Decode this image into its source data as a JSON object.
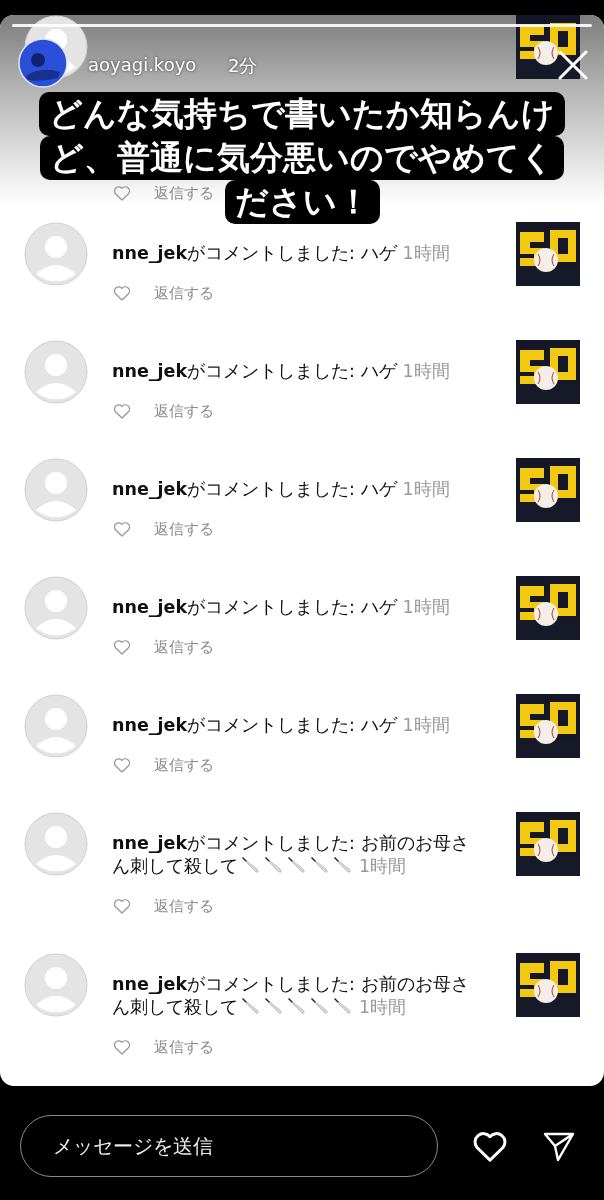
{
  "story_header": {
    "username": "aoyagi.koyo",
    "time": "2分"
  },
  "caption_lines": [
    "どんな気持ちで書いたか知らんけ",
    "ど、普通に気分悪いのでやめてく",
    "ださい！"
  ],
  "comments": [
    {
      "kind": "hidden",
      "reply": "返信する"
    },
    {
      "kind": "comment",
      "text_lines": [
        "**nne_jek**がコメントしました: ハゲ"
      ],
      "time": "1時間",
      "reply": "返信する"
    },
    {
      "kind": "comment",
      "text_lines": [
        "**nne_jek**がコメントしました: ハゲ"
      ],
      "time": "1時間",
      "reply": "返信する"
    },
    {
      "kind": "comment",
      "text_lines": [
        "**nne_jek**がコメントしました: ハゲ"
      ],
      "time": "1時間",
      "reply": "返信する"
    },
    {
      "kind": "comment",
      "text_lines": [
        "**nne_jek**がコメントしました: ハゲ"
      ],
      "time": "1時間",
      "reply": "返信する"
    },
    {
      "kind": "comment",
      "text_lines": [
        "**nne_jek**がコメントしました: ハゲ"
      ],
      "time": "1時間",
      "reply": "返信する"
    },
    {
      "kind": "comment",
      "text_lines": [
        "**nne_jek**がコメントしました: お前のお母さ",
        "ん刺して殺して"
      ],
      "emojis": [
        {
          "kind": "knife"
        },
        {
          "kind": "knife"
        },
        {
          "kind": "knife"
        },
        {
          "kind": "knife"
        },
        {
          "kind": "knife"
        }
      ],
      "time": "1時間",
      "reply": "返信する"
    },
    {
      "kind": "comment",
      "text_lines": [
        "**nne_jek**がコメントしました: お前のお母さ",
        "ん刺して殺して"
      ],
      "emojis": [
        {
          "kind": "knife"
        },
        {
          "kind": "knife"
        },
        {
          "kind": "knife"
        },
        {
          "kind": "knife"
        },
        {
          "kind": "knife"
        }
      ],
      "time": "1時間",
      "reply": "返信する"
    }
  ],
  "message_bar": {
    "placeholder": "メッセージを送信"
  }
}
